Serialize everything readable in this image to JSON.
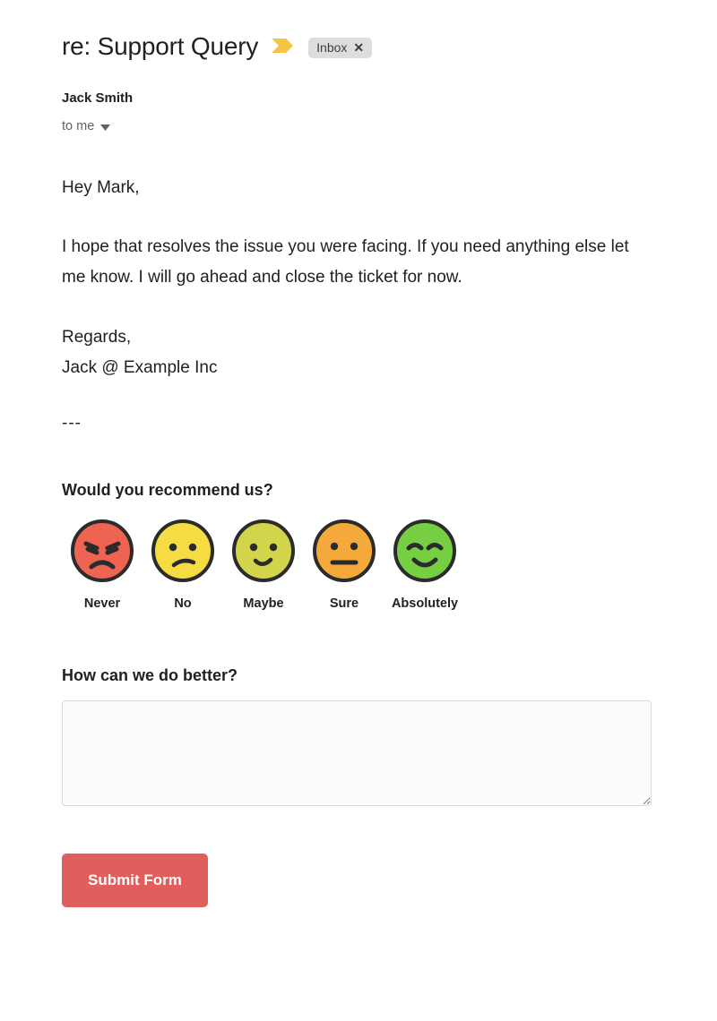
{
  "email": {
    "subject": "re: Support Query",
    "chevron_icon": "chevron-forward-icon",
    "label": {
      "name": "Inbox",
      "close_glyph": "✕",
      "background_color": "#ddddde"
    },
    "sender": {
      "name": "Jack Smith",
      "recipient": "to me",
      "expand_icon": "caret-down-icon"
    },
    "body": {
      "greeting": "Hey Mark,",
      "paragraph": "I hope that resolves the issue you were facing. If you need anything else let me know. I will go ahead and close the ticket for now.",
      "signoff": "Regards,",
      "signature": "Jack @ Example Inc",
      "divider": "---"
    }
  },
  "survey": {
    "question": "Would you recommend us?",
    "options": [
      {
        "label": "Never",
        "mood": "angry",
        "color": "#ee6352",
        "icon": "angry-face-icon"
      },
      {
        "label": "No",
        "mood": "sad",
        "color": "#f6dc43",
        "icon": "sad-face-icon"
      },
      {
        "label": "Maybe",
        "mood": "neutral",
        "color": "#d2d44b",
        "icon": "slight-smile-face-icon"
      },
      {
        "label": "Sure",
        "mood": "flat",
        "color": "#f6a93b",
        "icon": "neutral-face-icon"
      },
      {
        "label": "Absolutely",
        "mood": "happy",
        "color": "#76cf42",
        "icon": "happy-face-icon"
      }
    ]
  },
  "feedback": {
    "question": "How can we do better?",
    "value": "",
    "placeholder": ""
  },
  "actions": {
    "submit_label": "Submit Form",
    "submit_color": "#e05f5c"
  }
}
